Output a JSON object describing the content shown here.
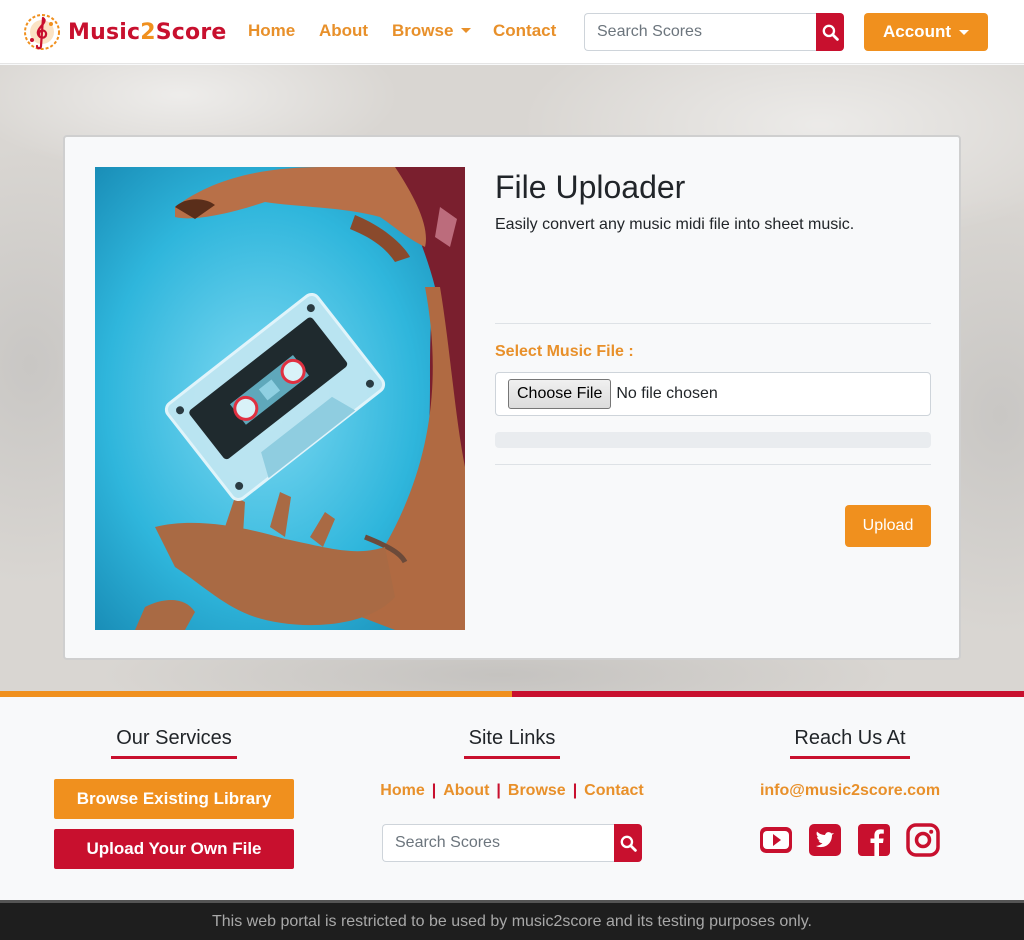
{
  "brand": {
    "name_part1": "Music",
    "name_part2": "2",
    "name_part3": "Score"
  },
  "nav": {
    "home": "Home",
    "about": "About",
    "browse": "Browse",
    "contact": "Contact",
    "search_placeholder": "Search Scores",
    "account": "Account"
  },
  "uploader": {
    "title": "File Uploader",
    "description": "Easily convert any music midi file into sheet music.",
    "select_label": "Select Music File :",
    "choose_button": "Choose File",
    "file_status": "No file chosen",
    "progress": 0,
    "upload_button": "Upload"
  },
  "footer": {
    "services_title": "Our Services",
    "browse_library": "Browse Existing Library",
    "upload_own": "Upload Your Own File",
    "site_links_title": "Site Links",
    "links": [
      "Home",
      "About",
      "Browse",
      "Contact"
    ],
    "search_placeholder": "Search Scores",
    "reach_title": "Reach Us At",
    "email": "info@music2score.com",
    "social": [
      "youtube-icon",
      "twitter-icon",
      "facebook-icon",
      "instagram-icon"
    ]
  },
  "bottom_bar": {
    "notice": "This web portal is restricted to be used by music2score and its testing purposes only."
  },
  "colors": {
    "orange": "#f0901e",
    "red": "#c8102e",
    "dark": "#1e1e1e"
  }
}
